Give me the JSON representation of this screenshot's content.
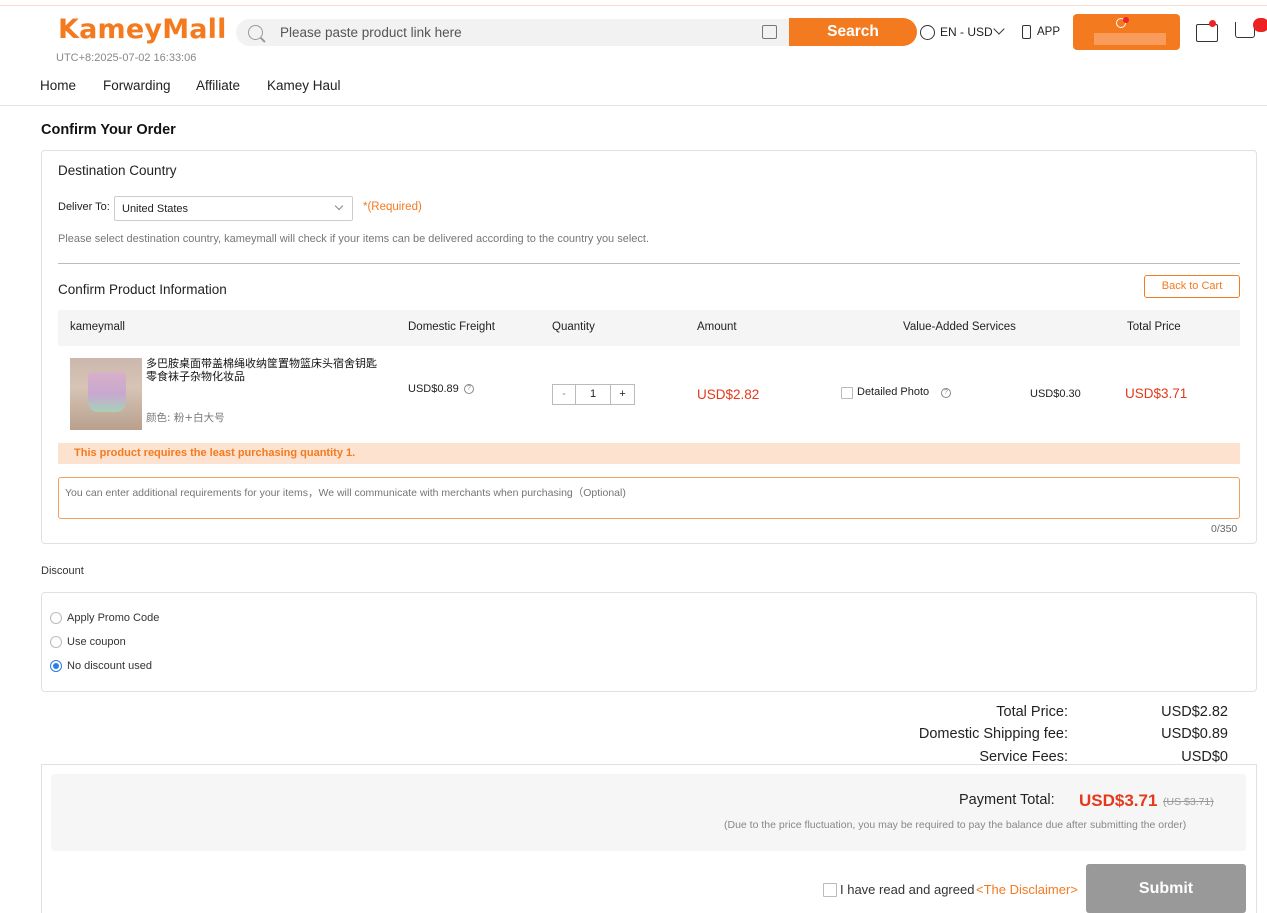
{
  "header": {
    "logo": "KameyMall",
    "clock": "UTC+8:2025-07-02 16:33:06",
    "search_placeholder": "Please paste product link here",
    "search_label": "Search",
    "language": "EN - USD",
    "app_label": "APP"
  },
  "nav": [
    "Home",
    "Forwarding",
    "Affiliate",
    "Kamey Haul"
  ],
  "page_title": "Confirm Your Order",
  "destination": {
    "title": "Destination Country",
    "deliver_label": "Deliver To:",
    "country": "United States",
    "required": "*(Required)",
    "hint": "Please select destination country, kameymall will check if your items can be delivered according to the country you select."
  },
  "product_section": {
    "title": "Confirm Product Information",
    "back_label": "Back to Cart",
    "columns": [
      "kameymall",
      "Domestic Freight",
      "Quantity",
      "Amount",
      "Value-Added Services",
      "Total Price"
    ],
    "item": {
      "name": "多巴胺桌面带盖棉绳收纳筐置物篮床头宿舍钥匙零食袜子杂物化妆品",
      "color": "颜色: 粉+白大号",
      "freight": "USD$0.89",
      "qty_minus": "-",
      "quantity": "1",
      "qty_plus": "+",
      "amount": "USD$2.82",
      "service_label": "Detailed Photo",
      "service_price": "USD$0.30",
      "total": "USD$3.71"
    },
    "warning": "This product requires the least purchasing quantity 1.",
    "note_placeholder": "You can enter additional requirements for your items，We will communicate with merchants when purchasing（Optional)",
    "note_counter": "0/350"
  },
  "discount": {
    "title": "Discount",
    "options": [
      "Apply Promo Code",
      "Use coupon",
      "No discount used"
    ],
    "selected_index": 2
  },
  "summary": {
    "rows": [
      {
        "label": "Total Price:",
        "value": "USD$2.82"
      },
      {
        "label": "Domestic Shipping fee:",
        "value": "USD$0.89"
      },
      {
        "label": "Service Fees:",
        "value": "USD$0"
      }
    ],
    "payment_label": "Payment Total:",
    "payment_value": "USD$3.71",
    "payment_alt": "(US $3.71)",
    "fluctuation_note": "(Due to the price fluctuation, you may be required to pay the balance due after submitting the order)",
    "agree_text": "I have read and agreed",
    "disclaimer_link": "<The Disclaimer>",
    "submit_label": "Submit"
  },
  "colors": {
    "brand": "#f47a20",
    "price_red": "#e4391b",
    "radio_blue": "#2b7de9"
  }
}
